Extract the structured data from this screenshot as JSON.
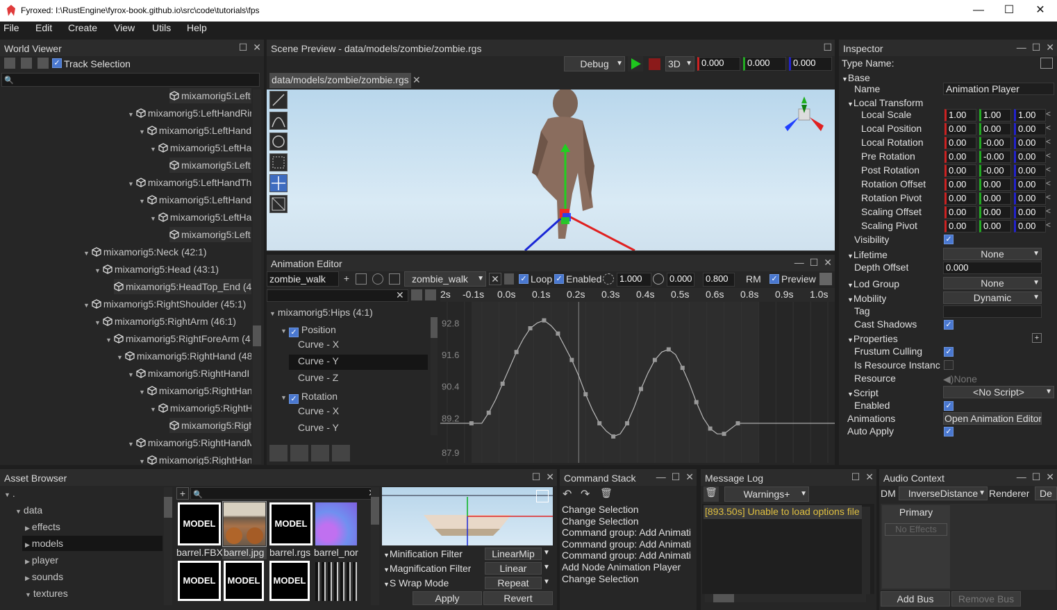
{
  "window": {
    "title": "Fyroxed: I:\\RustEngine\\fyrox-book.github.io\\src\\code\\tutorials\\fps",
    "minimize": "—",
    "maximize": "☐",
    "close": "✕"
  },
  "menu": [
    "File",
    "Edit",
    "Create",
    "View",
    "Utils",
    "Help"
  ],
  "world_viewer": {
    "title": "World Viewer",
    "track_selection": "Track Selection",
    "nodes": [
      {
        "t": "mixamorig5:Left",
        "x": 244,
        "arrow": false
      },
      {
        "t": "mixamorig5:LeftHandRin",
        "x": 184,
        "arrow": true
      },
      {
        "t": "mixamorig5:LeftHand",
        "x": 200,
        "arrow": true
      },
      {
        "t": "mixamorig5:LeftHa",
        "x": 216,
        "arrow": true
      },
      {
        "t": "mixamorig5:Left",
        "x": 244,
        "arrow": false
      },
      {
        "t": "mixamorig5:LeftHandTh",
        "x": 184,
        "arrow": true
      },
      {
        "t": "mixamorig5:LeftHand",
        "x": 200,
        "arrow": true
      },
      {
        "t": "mixamorig5:LeftHa",
        "x": 216,
        "arrow": true
      },
      {
        "t": "mixamorig5:Left",
        "x": 244,
        "arrow": false
      },
      {
        "t": "mixamorig5:Neck (42:1)",
        "x": 120,
        "arrow": true
      },
      {
        "t": "mixamorig5:Head (43:1)",
        "x": 136,
        "arrow": true
      },
      {
        "t": "mixamorig5:HeadTop_End (4",
        "x": 164,
        "arrow": false
      },
      {
        "t": "mixamorig5:RightShoulder (45:1)",
        "x": 120,
        "arrow": true
      },
      {
        "t": "mixamorig5:RightArm (46:1)",
        "x": 136,
        "arrow": true
      },
      {
        "t": "mixamorig5:RightForeArm (4",
        "x": 152,
        "arrow": true
      },
      {
        "t": "mixamorig5:RightHand (48",
        "x": 168,
        "arrow": true
      },
      {
        "t": "mixamorig5:RightHandI",
        "x": 184,
        "arrow": true
      },
      {
        "t": "mixamorig5:RightHan",
        "x": 200,
        "arrow": true
      },
      {
        "t": "mixamorig5:RightH",
        "x": 216,
        "arrow": true
      },
      {
        "t": "mixamorig5:Righ",
        "x": 244,
        "arrow": false
      },
      {
        "t": "mixamorig5:RightHandM",
        "x": 184,
        "arrow": true
      },
      {
        "t": "mixamorig5:RightHan",
        "x": 200,
        "arrow": true
      }
    ]
  },
  "scene_preview": {
    "title": "Scene Preview - data/models/zombie/zombie.rgs",
    "tab": "data/models/zombie/zombie.rgs",
    "mode": "Debug",
    "view": "3D",
    "values": [
      "0.000",
      "0.000",
      "0.000"
    ]
  },
  "animation_editor": {
    "title": "Animation Editor",
    "anim_name": "zombie_walk",
    "selected_anim": "zombie_walk",
    "loop": "Loop",
    "enabled": "Enabled",
    "speed": "1.000",
    "time_start": "0.000",
    "time_end": "0.800",
    "rm": "RM",
    "preview": "Preview",
    "ruler": [
      "2s",
      "-0.1s",
      "0.0s",
      "0.1s",
      "0.2s",
      "0.3s",
      "0.4s",
      "0.5s",
      "0.6s",
      "0.8s",
      "0.9s",
      "1.0s"
    ],
    "y_ticks": [
      "92.8",
      "91.6",
      "90.4",
      "89.2",
      "87.9"
    ],
    "tracks": {
      "root": "mixamorig5:Hips (4:1)",
      "position": "Position",
      "rotation": "Rotation",
      "curves_pos": [
        "Curve - X",
        "Curve - Y",
        "Curve - Z"
      ],
      "curves_rot": [
        "Curve - X",
        "Curve - Y"
      ]
    }
  },
  "inspector": {
    "title": "Inspector",
    "type_name": "Type Name:",
    "base": "Base",
    "name_label": "Name",
    "name_value": "Animation Player",
    "local_transform": "Local Transform",
    "transform_rows": [
      {
        "label": "Local Scale",
        "v": [
          "1.00",
          "1.00",
          "1.00"
        ]
      },
      {
        "label": "Local Position",
        "v": [
          "0.00",
          "0.00",
          "0.00"
        ]
      },
      {
        "label": "Local Rotation",
        "v": [
          "0.00",
          "-0.00",
          "0.00"
        ]
      },
      {
        "label": "Pre Rotation",
        "v": [
          "0.00",
          "-0.00",
          "0.00"
        ]
      },
      {
        "label": "Post Rotation",
        "v": [
          "0.00",
          "-0.00",
          "0.00"
        ]
      },
      {
        "label": "Rotation Offset",
        "v": [
          "0.00",
          "0.00",
          "0.00"
        ]
      },
      {
        "label": "Rotation Pivot",
        "v": [
          "0.00",
          "0.00",
          "0.00"
        ]
      },
      {
        "label": "Scaling Offset",
        "v": [
          "0.00",
          "0.00",
          "0.00"
        ]
      },
      {
        "label": "Scaling Pivot",
        "v": [
          "0.00",
          "0.00",
          "0.00"
        ]
      }
    ],
    "visibility": "Visibility",
    "lifetime": "Lifetime",
    "lifetime_value": "None",
    "depth_offset": "Depth Offset",
    "depth_value": "0.000",
    "lod_group": "Lod Group",
    "lod_value": "None",
    "mobility": "Mobility",
    "mobility_value": "Dynamic",
    "tag": "Tag",
    "cast_shadows": "Cast Shadows",
    "properties": "Properties",
    "frustum_culling": "Frustum Culling",
    "is_resource_instance": "Is Resource Instanc",
    "resource": "Resource",
    "resource_value": "None",
    "script": "Script",
    "script_value": "<No Script>",
    "enabled": "Enabled",
    "animations": "Animations",
    "animations_value": "Open Animation Editor",
    "auto_apply": "Auto Apply"
  },
  "asset_browser": {
    "title": "Asset Browser",
    "root": ".",
    "data": "data",
    "folders": [
      "effects",
      "models",
      "player",
      "sounds",
      "textures"
    ],
    "assets": [
      {
        "name": "barrel.FBX",
        "kind": "MODEL"
      },
      {
        "name": "barrel.jpg",
        "kind": "image"
      },
      {
        "name": "barrel.rgs",
        "kind": "MODEL"
      },
      {
        "name": "barrel_nor",
        "kind": "normal"
      }
    ],
    "row2": [
      "MODEL",
      "MODEL",
      "MODEL"
    ],
    "props": [
      {
        "label": "Minification Filter",
        "value": "LinearMip"
      },
      {
        "label": "Magnification Filter",
        "value": "Linear"
      },
      {
        "label": "S Wrap Mode",
        "value": "Repeat"
      }
    ],
    "apply": "Apply",
    "revert": "Revert"
  },
  "command_stack": {
    "title": "Command Stack",
    "items": [
      "Change Selection",
      "Change Selection",
      "Command group: Add Animati",
      "Command group: Add Animati",
      "Command group: Add Animati",
      "Add Node Animation Player",
      "Change Selection"
    ]
  },
  "message_log": {
    "title": "Message Log",
    "filter": "Warnings+",
    "messages": [
      "[893.50s] Unable to load options file"
    ]
  },
  "audio_context": {
    "title": "Audio Context",
    "dm": "DM",
    "dm_value": "InverseDistance",
    "renderer": "Renderer",
    "renderer_value": "De",
    "bus": "Primary",
    "no_effects": "No Effects",
    "add_bus": "Add Bus",
    "remove_bus": "Remove Bus"
  },
  "chart_data": {
    "type": "line",
    "x": [
      -0.03,
      0.0,
      0.02,
      0.04,
      0.06,
      0.08,
      0.1,
      0.12,
      0.14,
      0.16,
      0.18,
      0.2,
      0.22,
      0.24,
      0.26,
      0.28,
      0.3,
      0.32,
      0.34,
      0.36,
      0.38,
      0.4,
      0.42,
      0.44,
      0.46,
      0.48,
      0.5,
      0.52,
      0.54,
      0.56,
      0.58,
      0.6,
      0.62,
      0.64,
      0.66,
      0.68,
      0.7,
      0.72,
      0.74,
      0.76,
      0.78,
      0.8
    ],
    "y": [
      89.0,
      89.0,
      89.4,
      89.9,
      90.5,
      91.1,
      91.7,
      92.2,
      92.6,
      92.8,
      92.9,
      92.7,
      92.4,
      91.9,
      91.4,
      90.8,
      90.1,
      89.5,
      89.0,
      88.7,
      88.5,
      88.6,
      89.0,
      89.6,
      90.3,
      90.9,
      91.4,
      91.7,
      91.8,
      91.6,
      91.1,
      90.5,
      89.8,
      89.2,
      88.8,
      88.6,
      88.6,
      88.8,
      89.0
    ]
  }
}
